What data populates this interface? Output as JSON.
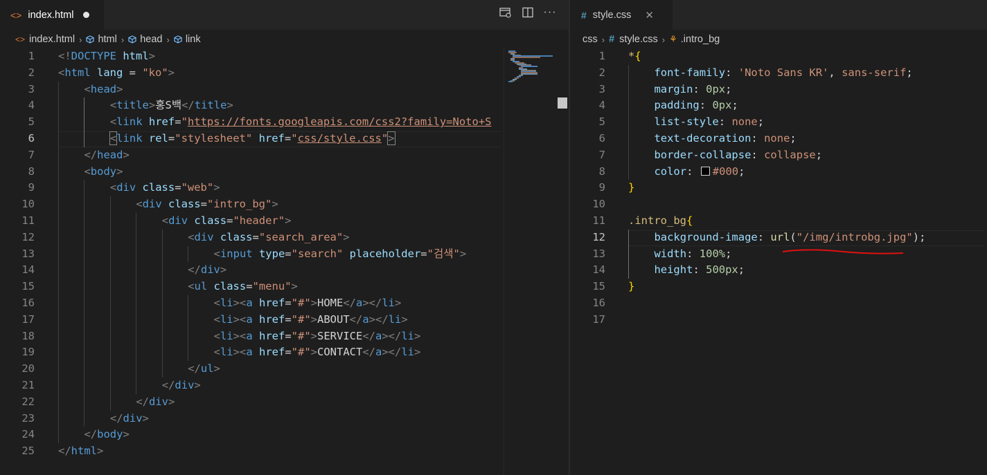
{
  "left": {
    "tab": {
      "icon": "html-file-icon",
      "label": "index.html"
    },
    "breadcrumb": [
      "index.html",
      "html",
      "head",
      "link"
    ],
    "lines": [
      {
        "n": "1",
        "t": [
          [
            "punc",
            "<!"
          ],
          [
            "tag",
            "DOCTYPE "
          ],
          [
            "attr",
            "html"
          ],
          [
            "punc",
            ">"
          ]
        ]
      },
      {
        "n": "2",
        "t": [
          [
            "punc",
            "<"
          ],
          [
            "tag",
            "html "
          ],
          [
            "attr",
            "lang"
          ],
          [
            "txt",
            " = "
          ],
          [
            "str",
            "\"ko\""
          ],
          [
            "punc",
            ">"
          ]
        ]
      },
      {
        "n": "3",
        "t": [
          [
            "punc",
            "<"
          ],
          [
            "tag",
            "head"
          ],
          [
            "punc",
            ">"
          ]
        ]
      },
      {
        "n": "4",
        "t": [
          [
            "punc",
            "<"
          ],
          [
            "tag",
            "title"
          ],
          [
            "punc",
            ">"
          ],
          [
            "txt",
            "홍S백"
          ],
          [
            "punc",
            "</"
          ],
          [
            "tag",
            "title"
          ],
          [
            "punc",
            ">"
          ]
        ]
      },
      {
        "n": "5",
        "t": [
          [
            "punc",
            "<"
          ],
          [
            "tag",
            "link "
          ],
          [
            "attr",
            "href"
          ],
          [
            "txt",
            "="
          ],
          [
            "str",
            "\""
          ],
          [
            "url",
            "https://fonts.googleapis.com/css2?family=Noto+S"
          ]
        ]
      },
      {
        "n": "6",
        "t": [
          [
            "boxpunc",
            "<"
          ],
          [
            "tag",
            "link "
          ],
          [
            "attr",
            "rel"
          ],
          [
            "txt",
            "="
          ],
          [
            "str",
            "\"stylesheet\" "
          ],
          [
            "attr",
            "href"
          ],
          [
            "txt",
            "="
          ],
          [
            "str",
            "\""
          ],
          [
            "url",
            "css/style.css"
          ],
          [
            "str",
            "\""
          ],
          [
            "boxpunc",
            ">"
          ]
        ]
      },
      {
        "n": "7",
        "t": [
          [
            "punc",
            "</"
          ],
          [
            "tag",
            "head"
          ],
          [
            "punc",
            ">"
          ]
        ]
      },
      {
        "n": "8",
        "t": [
          [
            "punc",
            "<"
          ],
          [
            "tag",
            "body"
          ],
          [
            "punc",
            ">"
          ]
        ]
      },
      {
        "n": "9",
        "t": [
          [
            "punc",
            "<"
          ],
          [
            "tag",
            "div "
          ],
          [
            "attr",
            "class"
          ],
          [
            "txt",
            "="
          ],
          [
            "str",
            "\"web\""
          ],
          [
            "punc",
            ">"
          ]
        ]
      },
      {
        "n": "10",
        "t": [
          [
            "punc",
            "<"
          ],
          [
            "tag",
            "div "
          ],
          [
            "attr",
            "class"
          ],
          [
            "txt",
            "="
          ],
          [
            "str",
            "\"intro_bg\""
          ],
          [
            "punc",
            ">"
          ]
        ]
      },
      {
        "n": "11",
        "t": [
          [
            "punc",
            "<"
          ],
          [
            "tag",
            "div "
          ],
          [
            "attr",
            "class"
          ],
          [
            "txt",
            "="
          ],
          [
            "str",
            "\"header\""
          ],
          [
            "punc",
            ">"
          ]
        ]
      },
      {
        "n": "12",
        "t": [
          [
            "punc",
            "<"
          ],
          [
            "tag",
            "div "
          ],
          [
            "attr",
            "class"
          ],
          [
            "txt",
            "="
          ],
          [
            "str",
            "\"search_area\""
          ],
          [
            "punc",
            ">"
          ]
        ]
      },
      {
        "n": "13",
        "t": [
          [
            "punc",
            "<"
          ],
          [
            "tag",
            "input "
          ],
          [
            "attr",
            "type"
          ],
          [
            "txt",
            "="
          ],
          [
            "str",
            "\"search\" "
          ],
          [
            "attr",
            "placeholder"
          ],
          [
            "txt",
            "="
          ],
          [
            "str",
            "\"검색\""
          ],
          [
            "punc",
            ">"
          ]
        ]
      },
      {
        "n": "14",
        "t": [
          [
            "punc",
            "</"
          ],
          [
            "tag",
            "div"
          ],
          [
            "punc",
            ">"
          ]
        ]
      },
      {
        "n": "15",
        "t": [
          [
            "punc",
            "<"
          ],
          [
            "tag",
            "ul "
          ],
          [
            "attr",
            "class"
          ],
          [
            "txt",
            "="
          ],
          [
            "str",
            "\"menu\""
          ],
          [
            "punc",
            ">"
          ]
        ]
      },
      {
        "n": "16",
        "t": [
          [
            "punc",
            "<"
          ],
          [
            "tag",
            "li"
          ],
          [
            "punc",
            "><"
          ],
          [
            "tag",
            "a "
          ],
          [
            "attr",
            "href"
          ],
          [
            "txt",
            "="
          ],
          [
            "str",
            "\"#\""
          ],
          [
            "punc",
            ">"
          ],
          [
            "txt",
            "HOME"
          ],
          [
            "punc",
            "</"
          ],
          [
            "tag",
            "a"
          ],
          [
            "punc",
            "></"
          ],
          [
            "tag",
            "li"
          ],
          [
            "punc",
            ">"
          ]
        ]
      },
      {
        "n": "17",
        "t": [
          [
            "punc",
            "<"
          ],
          [
            "tag",
            "li"
          ],
          [
            "punc",
            "><"
          ],
          [
            "tag",
            "a "
          ],
          [
            "attr",
            "href"
          ],
          [
            "txt",
            "="
          ],
          [
            "str",
            "\"#\""
          ],
          [
            "punc",
            ">"
          ],
          [
            "txt",
            "ABOUT"
          ],
          [
            "punc",
            "</"
          ],
          [
            "tag",
            "a"
          ],
          [
            "punc",
            "></"
          ],
          [
            "tag",
            "li"
          ],
          [
            "punc",
            ">"
          ]
        ]
      },
      {
        "n": "18",
        "t": [
          [
            "punc",
            "<"
          ],
          [
            "tag",
            "li"
          ],
          [
            "punc",
            "><"
          ],
          [
            "tag",
            "a "
          ],
          [
            "attr",
            "href"
          ],
          [
            "txt",
            "="
          ],
          [
            "str",
            "\"#\""
          ],
          [
            "punc",
            ">"
          ],
          [
            "txt",
            "SERVICE"
          ],
          [
            "punc",
            "</"
          ],
          [
            "tag",
            "a"
          ],
          [
            "punc",
            "></"
          ],
          [
            "tag",
            "li"
          ],
          [
            "punc",
            ">"
          ]
        ]
      },
      {
        "n": "19",
        "t": [
          [
            "punc",
            "<"
          ],
          [
            "tag",
            "li"
          ],
          [
            "punc",
            "><"
          ],
          [
            "tag",
            "a "
          ],
          [
            "attr",
            "href"
          ],
          [
            "txt",
            "="
          ],
          [
            "str",
            "\"#\""
          ],
          [
            "punc",
            ">"
          ],
          [
            "txt",
            "CONTACT"
          ],
          [
            "punc",
            "</"
          ],
          [
            "tag",
            "a"
          ],
          [
            "punc",
            "></"
          ],
          [
            "tag",
            "li"
          ],
          [
            "punc",
            ">"
          ]
        ]
      },
      {
        "n": "20",
        "t": [
          [
            "punc",
            "</"
          ],
          [
            "tag",
            "ul"
          ],
          [
            "punc",
            ">"
          ]
        ]
      },
      {
        "n": "21",
        "t": [
          [
            "punc",
            "</"
          ],
          [
            "tag",
            "div"
          ],
          [
            "punc",
            ">"
          ]
        ]
      },
      {
        "n": "22",
        "t": [
          [
            "punc",
            "</"
          ],
          [
            "tag",
            "div"
          ],
          [
            "punc",
            ">"
          ]
        ]
      },
      {
        "n": "23",
        "t": [
          [
            "punc",
            "</"
          ],
          [
            "tag",
            "div"
          ],
          [
            "punc",
            ">"
          ]
        ]
      },
      {
        "n": "24",
        "t": [
          [
            "punc",
            "</"
          ],
          [
            "tag",
            "body"
          ],
          [
            "punc",
            ">"
          ]
        ]
      },
      {
        "n": "25",
        "t": [
          [
            "punc",
            "</"
          ],
          [
            "tag",
            "html"
          ],
          [
            "punc",
            ">"
          ]
        ]
      }
    ]
  },
  "right": {
    "tab": {
      "icon": "css-file-icon",
      "label": "style.css"
    },
    "breadcrumb": [
      "css",
      "style.css",
      ".intro_bg"
    ],
    "lines": [
      {
        "n": "1",
        "t": [
          [
            "sel",
            "*"
          ],
          [
            "brace",
            "{"
          ]
        ]
      },
      {
        "n": "2",
        "t": [
          [
            "prop",
            "font-family"
          ],
          [
            "txt",
            ": "
          ],
          [
            "val",
            "'Noto Sans KR'"
          ],
          [
            "txt",
            ", "
          ],
          [
            "val",
            "sans-serif"
          ],
          [
            "txt",
            ";"
          ]
        ]
      },
      {
        "n": "3",
        "t": [
          [
            "prop",
            "margin"
          ],
          [
            "txt",
            ": "
          ],
          [
            "num",
            "0px"
          ],
          [
            "txt",
            ";"
          ]
        ]
      },
      {
        "n": "4",
        "t": [
          [
            "prop",
            "padding"
          ],
          [
            "txt",
            ": "
          ],
          [
            "num",
            "0px"
          ],
          [
            "txt",
            ";"
          ]
        ]
      },
      {
        "n": "5",
        "t": [
          [
            "prop",
            "list-style"
          ],
          [
            "txt",
            ": "
          ],
          [
            "val",
            "none"
          ],
          [
            "txt",
            ";"
          ]
        ]
      },
      {
        "n": "6",
        "t": [
          [
            "prop",
            "text-decoration"
          ],
          [
            "txt",
            ": "
          ],
          [
            "val",
            "none"
          ],
          [
            "txt",
            ";"
          ]
        ]
      },
      {
        "n": "7",
        "t": [
          [
            "prop",
            "border-collapse"
          ],
          [
            "txt",
            ": "
          ],
          [
            "val",
            "collapse"
          ],
          [
            "txt",
            ";"
          ]
        ]
      },
      {
        "n": "8",
        "t": [
          [
            "prop",
            "color"
          ],
          [
            "txt",
            ": "
          ],
          [
            "swatch",
            ""
          ],
          [
            "val",
            "#000"
          ],
          [
            "txt",
            ";"
          ]
        ]
      },
      {
        "n": "9",
        "t": [
          [
            "brace",
            "}"
          ]
        ]
      },
      {
        "n": "10",
        "t": []
      },
      {
        "n": "11",
        "t": [
          [
            "sel",
            ".intro_bg"
          ],
          [
            "brace",
            "{"
          ]
        ]
      },
      {
        "n": "12",
        "t": [
          [
            "prop",
            "background-image"
          ],
          [
            "txt",
            ": "
          ],
          [
            "fn",
            "url"
          ],
          [
            "txt",
            "("
          ],
          [
            "val",
            "\"/img/introbg.jpg\""
          ],
          [
            "txt",
            ");"
          ]
        ]
      },
      {
        "n": "13",
        "t": [
          [
            "prop",
            "width"
          ],
          [
            "txt",
            ": "
          ],
          [
            "num",
            "100%"
          ],
          [
            "txt",
            ";"
          ]
        ]
      },
      {
        "n": "14",
        "t": [
          [
            "prop",
            "height"
          ],
          [
            "txt",
            ": "
          ],
          [
            "num",
            "500px"
          ],
          [
            "txt",
            ";"
          ]
        ]
      },
      {
        "n": "15",
        "t": [
          [
            "brace",
            "}"
          ]
        ]
      },
      {
        "n": "16",
        "t": []
      },
      {
        "n": "17",
        "t": []
      }
    ]
  },
  "icons": {
    "split_preview": "open-preview-icon",
    "split_editor": "split-editor-icon",
    "more": "more-actions-icon",
    "close": "close-icon"
  }
}
